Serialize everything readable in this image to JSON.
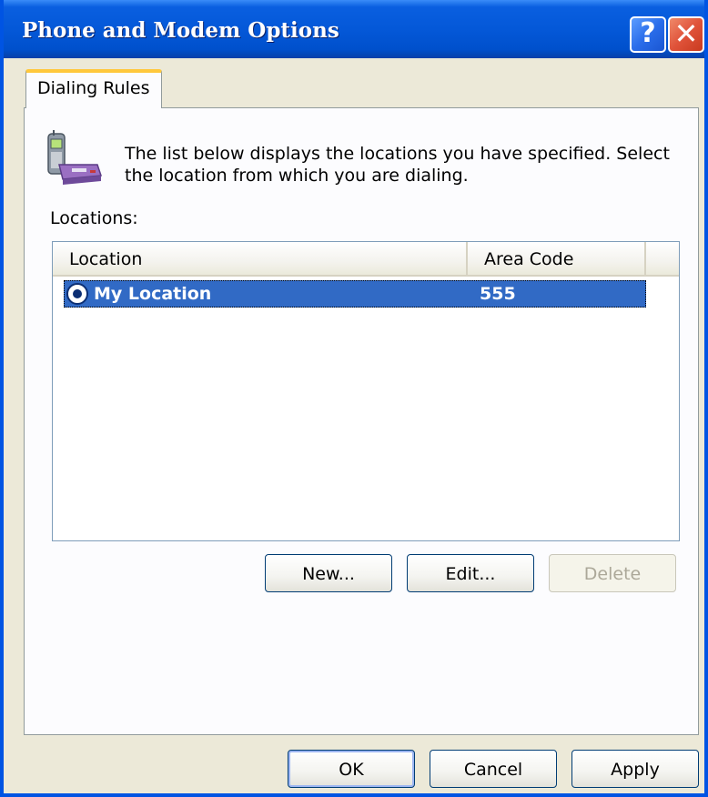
{
  "window": {
    "title": "Phone and Modem Options",
    "help_glyph": "?",
    "close_glyph": "✕"
  },
  "tabs": [
    {
      "label": "Dialing Rules",
      "selected": true
    }
  ],
  "intro": {
    "icon": "phone-modem-icon",
    "text": "The list below displays the locations you have specified. Select the location from which you are dialing."
  },
  "locations": {
    "label": "Locations:",
    "columns": [
      "Location",
      "Area Code"
    ],
    "rows": [
      {
        "location": "My Location",
        "area_code": "555",
        "selected": true
      }
    ]
  },
  "list_buttons": {
    "new": "New...",
    "edit": "Edit...",
    "delete": "Delete"
  },
  "dialog_buttons": {
    "ok": "OK",
    "cancel": "Cancel",
    "apply": "Apply"
  },
  "colors": {
    "titlebar": "#0458D8",
    "selection": "#316AC5",
    "tab_highlight": "#FFC83C"
  }
}
